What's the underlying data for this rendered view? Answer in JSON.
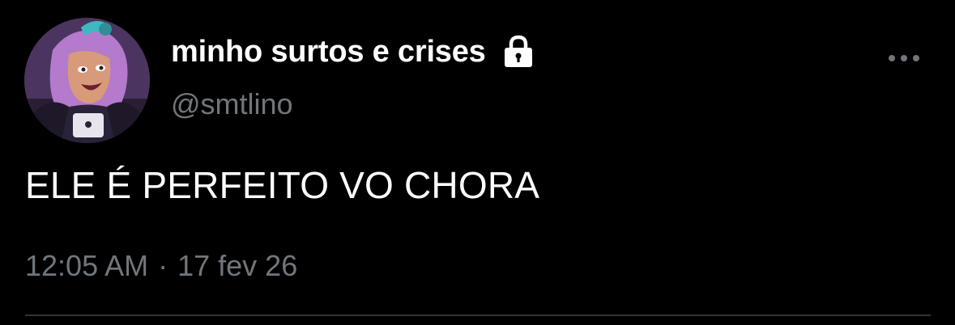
{
  "user": {
    "display_name": "minho surtos e crises",
    "handle": "@smtlino",
    "protected_icon": "lock-icon",
    "avatar_icon": "avatar-cartoon-character"
  },
  "tweet": {
    "text": "ELE É PERFEITO VO CHORA",
    "time": "12:05 AM",
    "separator": "·",
    "date": "17 fev 26"
  },
  "actions": {
    "more_icon": "more-horizontal-icon"
  },
  "colors": {
    "background": "#000000",
    "primary_text": "#ffffff",
    "secondary_text": "#71767b",
    "divider": "#2f3336"
  }
}
